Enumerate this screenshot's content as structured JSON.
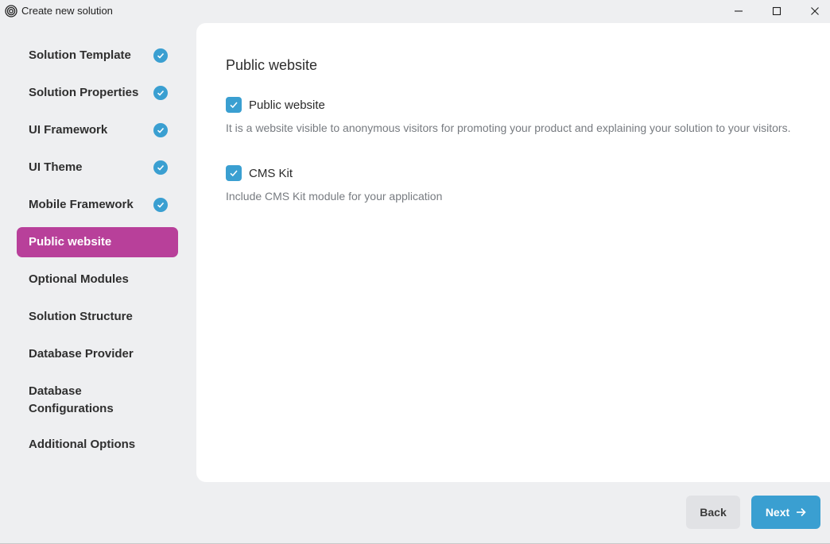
{
  "window": {
    "title": "Create new solution",
    "icons": {
      "app": "spiral-logo-icon",
      "minimize": "minimize-icon",
      "maximize": "maximize-icon",
      "close": "close-icon"
    }
  },
  "sidebar": {
    "items": [
      {
        "label": "Solution Template",
        "completed": true
      },
      {
        "label": "Solution Properties",
        "completed": true
      },
      {
        "label": "UI Framework",
        "completed": true
      },
      {
        "label": "UI Theme",
        "completed": true
      },
      {
        "label": "Mobile Framework",
        "completed": true
      },
      {
        "label": "Public website",
        "completed": false,
        "active": true
      },
      {
        "label": "Optional Modules",
        "completed": false
      },
      {
        "label": "Solution Structure",
        "completed": false
      },
      {
        "label": "Database Provider",
        "completed": false
      },
      {
        "label": "Database Configurations",
        "completed": false
      },
      {
        "label": "Additional Options",
        "completed": false
      }
    ]
  },
  "main": {
    "title": "Public website",
    "options": [
      {
        "label": "Public website",
        "checked": true,
        "description": "It is a website visible to anonymous visitors for promoting your product and explaining your solution to your visitors."
      },
      {
        "label": "CMS Kit",
        "checked": true,
        "description": "Include CMS Kit module for your application"
      }
    ]
  },
  "footer": {
    "back_label": "Back",
    "next_label": "Next"
  },
  "colors": {
    "accent": "#3a9fd1",
    "active_nav": "#b8409a",
    "background": "#eeeff1",
    "panel": "#ffffff"
  }
}
